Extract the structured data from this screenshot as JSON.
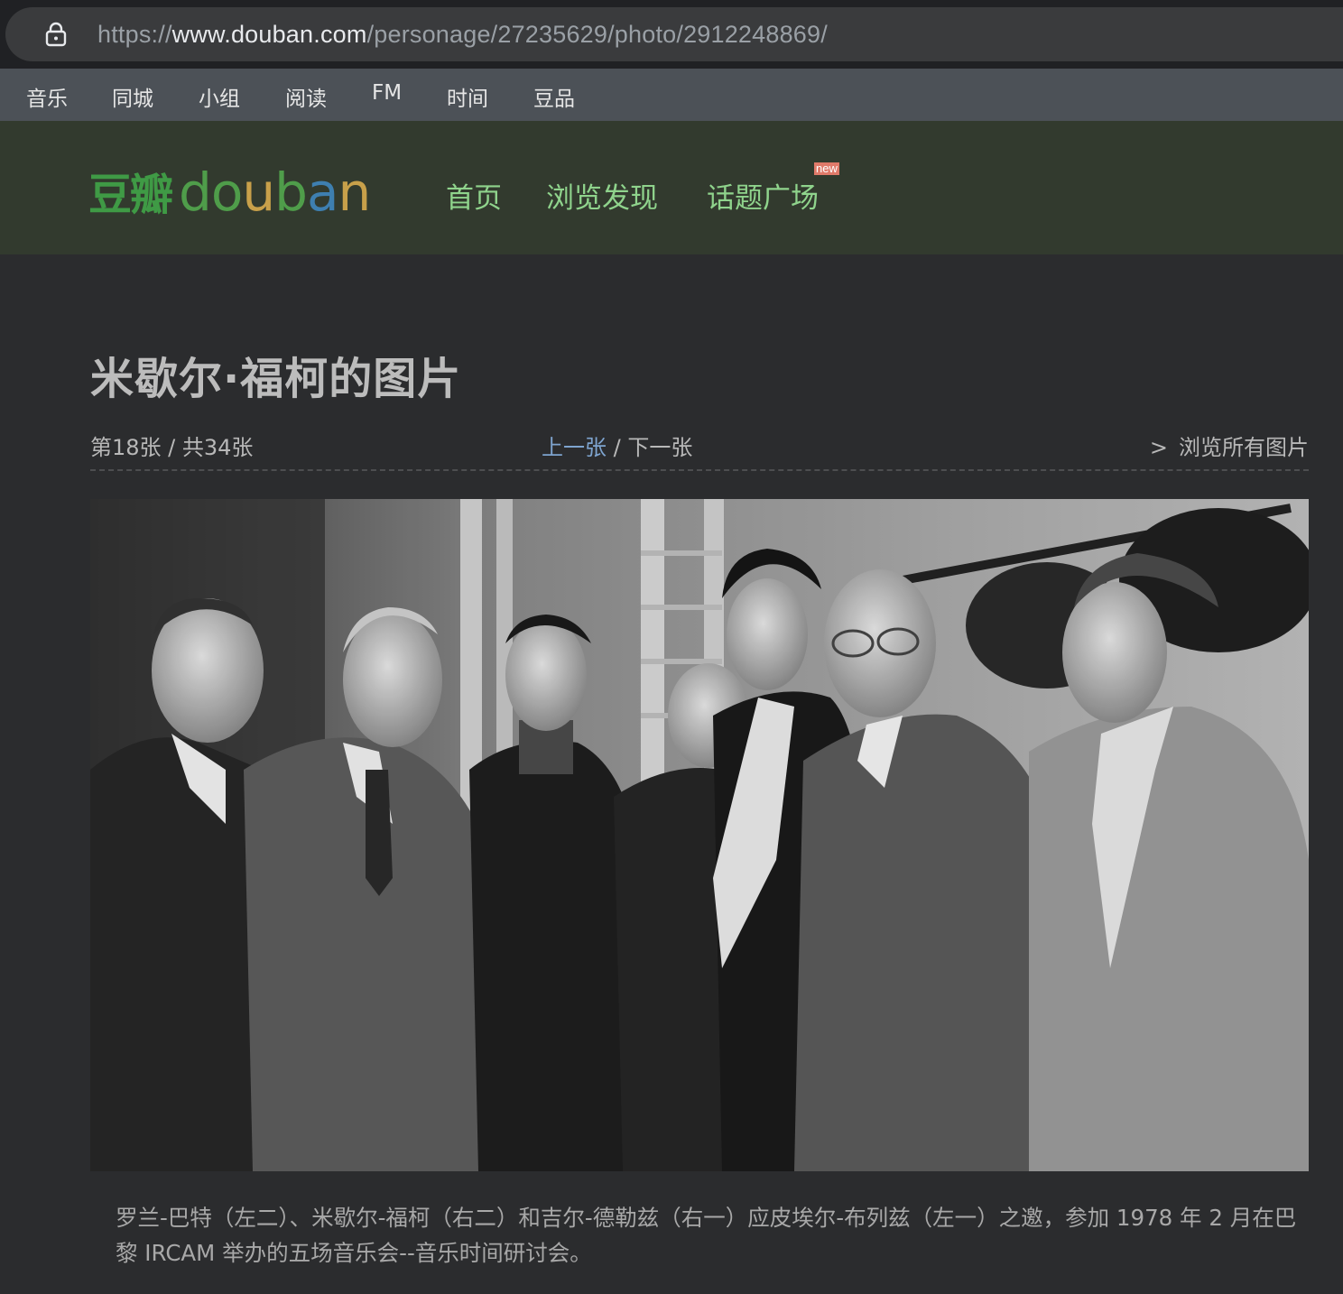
{
  "browser": {
    "url_scheme": "https://",
    "url_host": "www.douban.com",
    "url_path": "/personage/27235629/photo/2912248869/"
  },
  "global_nav": [
    "音乐",
    "同城",
    "小组",
    "阅读",
    "FM",
    "时间",
    "豆品"
  ],
  "header": {
    "logo_cn": "豆瓣",
    "logo_en": "douban",
    "nav": [
      "首页",
      "浏览发现",
      "话题广场"
    ],
    "new_badge": "new"
  },
  "page": {
    "title": "米歇尔·福柯的图片",
    "counter": "第18张 / 共34张",
    "prev": "上一张",
    "separator": " / ",
    "next": "下一张",
    "view_all_arrow": ">",
    "view_all": "浏览所有图片",
    "caption": "罗兰-巴特（左二）、米歇尔-福柯（右二）和吉尔-德勒兹（右一）应皮埃尔-布列兹（左一）之邀，参加 1978 年 2 月在巴黎 IRCAM 举办的五场音乐会--音乐时间研讨会。"
  },
  "colors": {
    "page_bg": "#2b2c2e",
    "header_bg": "#323a2e",
    "nav_green": "#8fd38c",
    "link_blue": "#7ea4cf"
  }
}
